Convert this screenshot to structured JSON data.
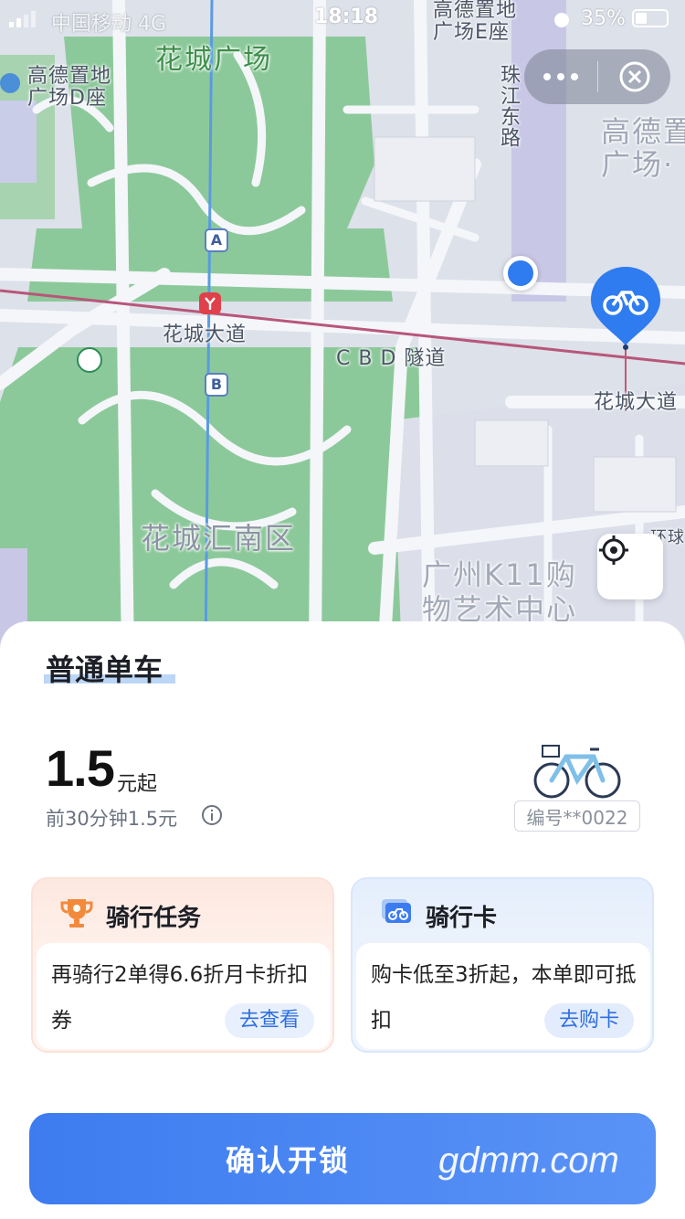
{
  "status_bar": {
    "carrier": "中国移动  4G",
    "time": "18:18",
    "battery": "35%"
  },
  "map": {
    "labels": {
      "huacheng_square": "花城广场",
      "gaode_d": "高德置地\n广场D座",
      "gaode_e": "高德置地\n广场E座",
      "zhujiang_road": "珠江东路",
      "gaode_right": "高德置\n广场·",
      "metro_a": "A",
      "metro_b": "B",
      "huacheng_avenue": "花城大道",
      "cbd_tunnel": "C B D 隧道",
      "huacheng_avenue_right": "花城大道",
      "huachenghui_south": "花城汇南区",
      "k11": "广州K11购\n物艺术中心",
      "huanshi": "环球"
    }
  },
  "capsule": {
    "more_icon": "more-dots-icon",
    "close_icon": "close-circle-icon"
  },
  "sheet": {
    "bike_type": "普通单车",
    "price": "1.5",
    "price_unit": "元起",
    "price_desc": "前30分钟1.5元",
    "bike_number": "编号**0022",
    "cards": {
      "task": {
        "title": "骑行任务",
        "desc": "再骑行2单得6.6折月卡折扣券",
        "action": "去查看"
      },
      "pass": {
        "title": "骑行卡",
        "desc": "购卡低至3折起，本单即可抵扣",
        "action": "去购卡"
      }
    },
    "unlock_button": "确认开锁"
  },
  "watermark": "gdmm.com",
  "colors": {
    "primary_blue": "#3d7cf0",
    "map_green": "#8cc99a",
    "metro_line": "#c0587a"
  }
}
